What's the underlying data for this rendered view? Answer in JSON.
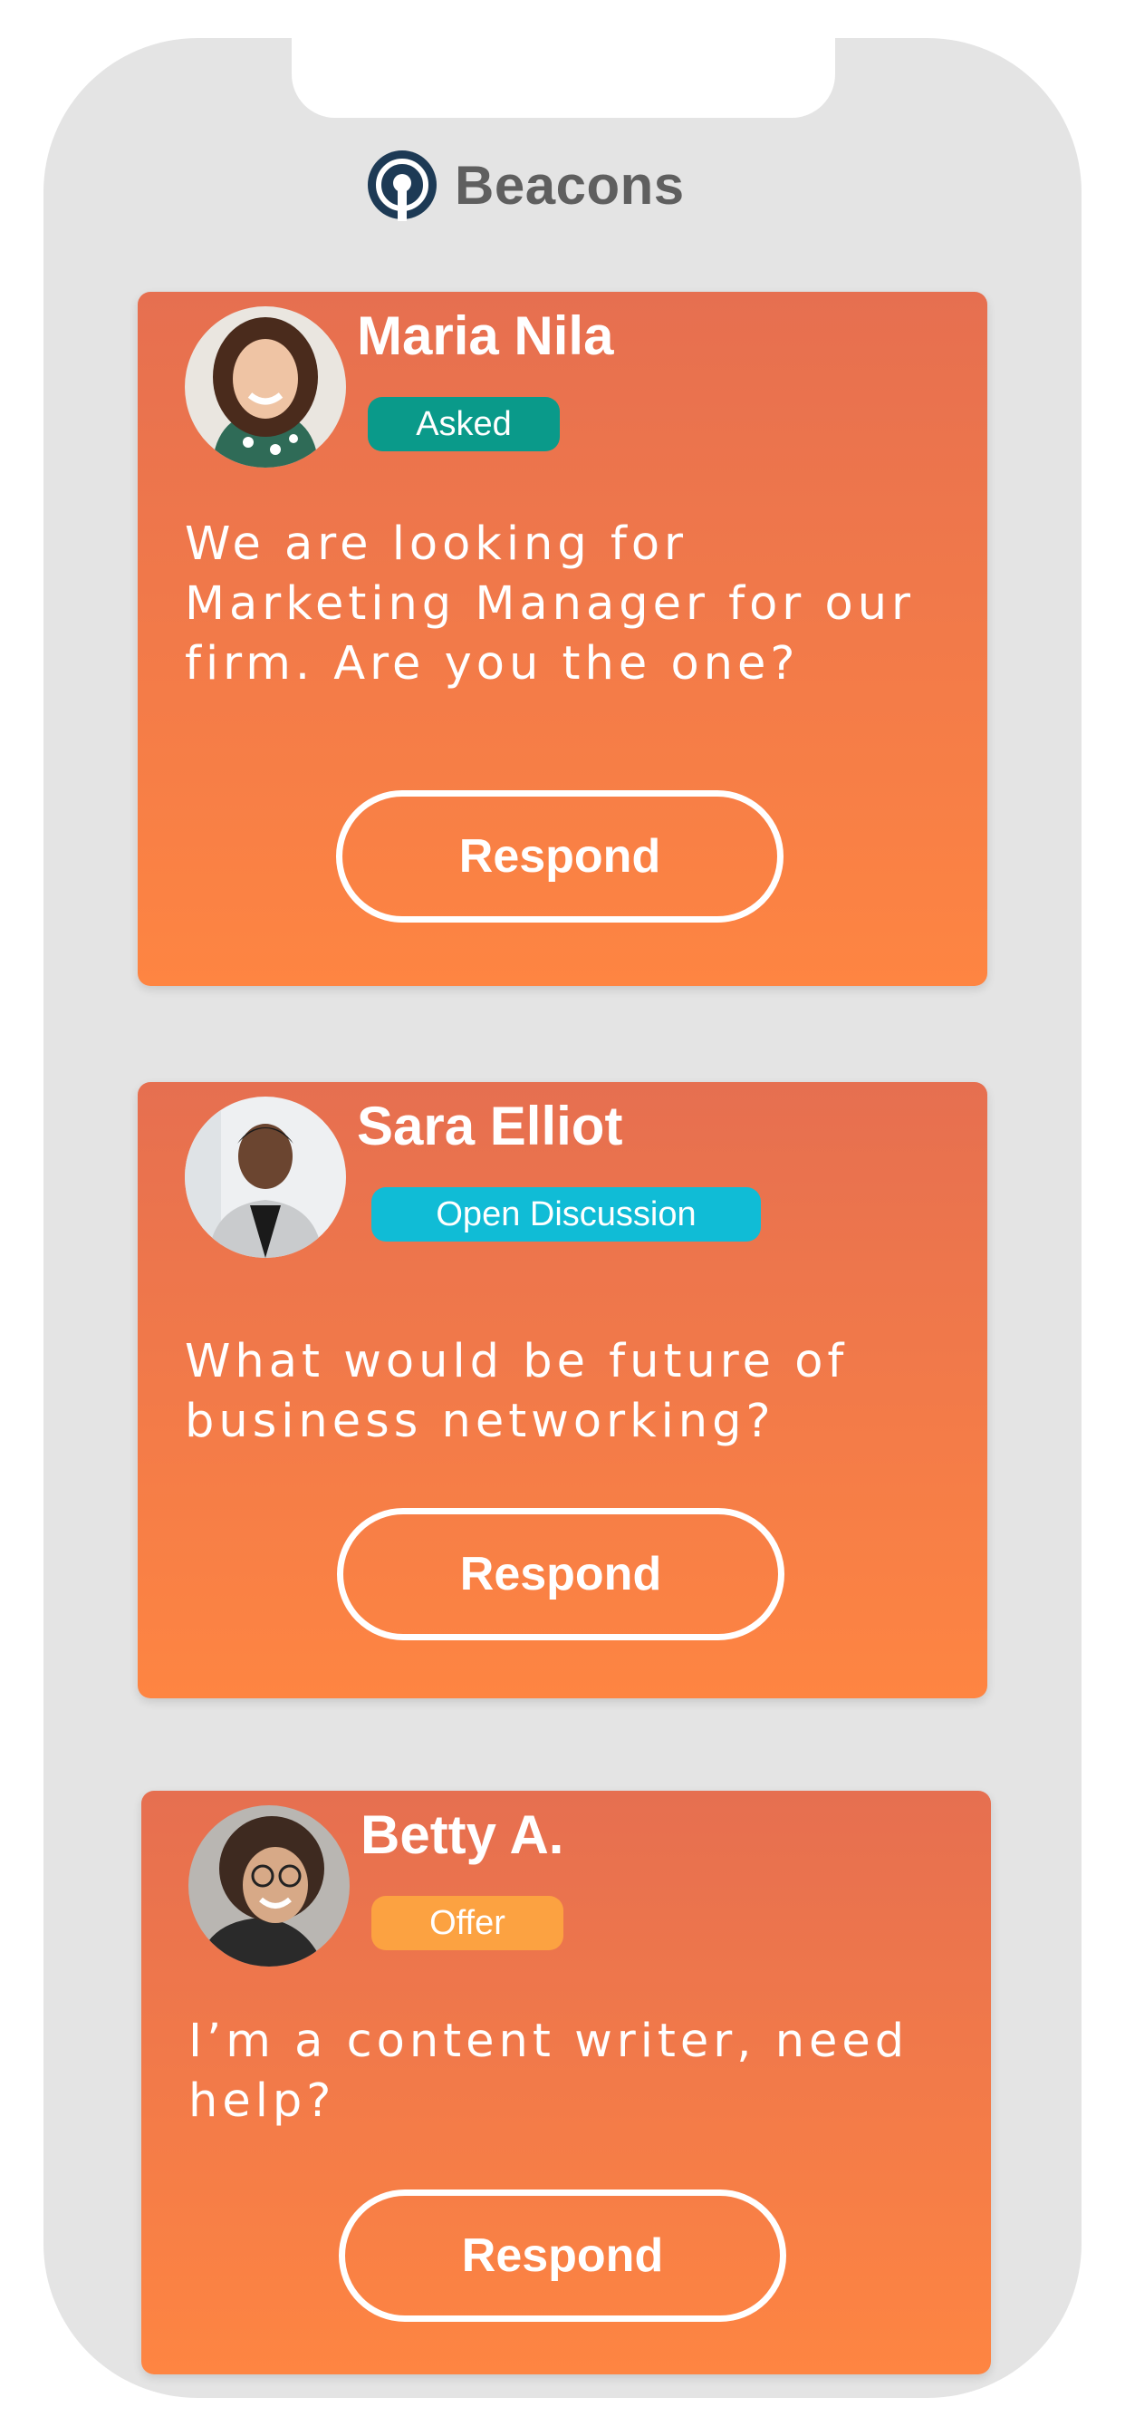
{
  "app": {
    "title": "Beacons",
    "colors": {
      "brand_dark": "#1d3a55",
      "card_top": "#e66f50",
      "card_bottom": "#fe8542",
      "asked": "#0a9a8a",
      "open_discussion": "#10bcd6",
      "offer": "#fca241"
    }
  },
  "cards": [
    {
      "name": "Maria Nila",
      "badge": "Asked",
      "message": "We are looking for Marketing Manager for our firm. Are you the one?",
      "button": "Respond"
    },
    {
      "name": "Sara Elliot",
      "badge": "Open Discussion",
      "message": "What would be future of business networking?",
      "button": "Respond"
    },
    {
      "name": "Betty A.",
      "badge": "Offer",
      "message": "I’m a content writer, need help?",
      "button": "Respond"
    }
  ]
}
